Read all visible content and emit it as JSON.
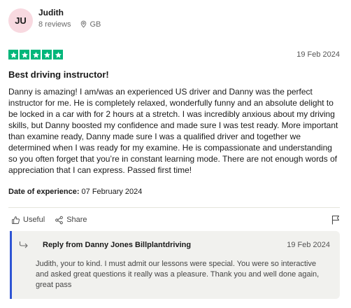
{
  "reviewer": {
    "initials": "JU",
    "name": "Judith",
    "reviews_count": "8 reviews",
    "country": "GB"
  },
  "review": {
    "rating": 5,
    "date": "19 Feb 2024",
    "title": "Best driving instructor!",
    "body": "Danny is amazing! I am/was an experienced US driver and Danny was the perfect instructor for me. He is completely relaxed, wonderfully funny and an absolute delight to be locked in a car with for 2 hours at a stretch. I was incredibly anxious about my driving skills, but Danny boosted my confidence and made sure I was test ready. More important than examine ready, Danny made sure I was a qualified driver and together we determined when I was ready for my examine. He is compassionate and understanding so you often forget that you’re in constant learning mode. There are not enough words of appreciation that I can express. Passed first time!",
    "experience_label": "Date of experience:",
    "experience_date": "07 February 2024"
  },
  "actions": {
    "useful_label": "Useful",
    "share_label": "Share"
  },
  "reply": {
    "from": "Reply from Danny Jones Billplantdriving",
    "date": "19 Feb 2024",
    "text": "Judith, your to kind. I must admit our lessons were special. You were so interactive and asked great questions it really was a pleasure. Thank you and well done again, great pass"
  },
  "colors": {
    "star_green": "#00b67a",
    "avatar_bg": "#f8d9e0",
    "reply_accent": "#2f55d4",
    "reply_bg": "#f1f1ee"
  },
  "icons": [
    "location-pin-icon",
    "star-icon",
    "thumbs-up-icon",
    "share-icon",
    "flag-icon",
    "reply-arrow-icon"
  ]
}
